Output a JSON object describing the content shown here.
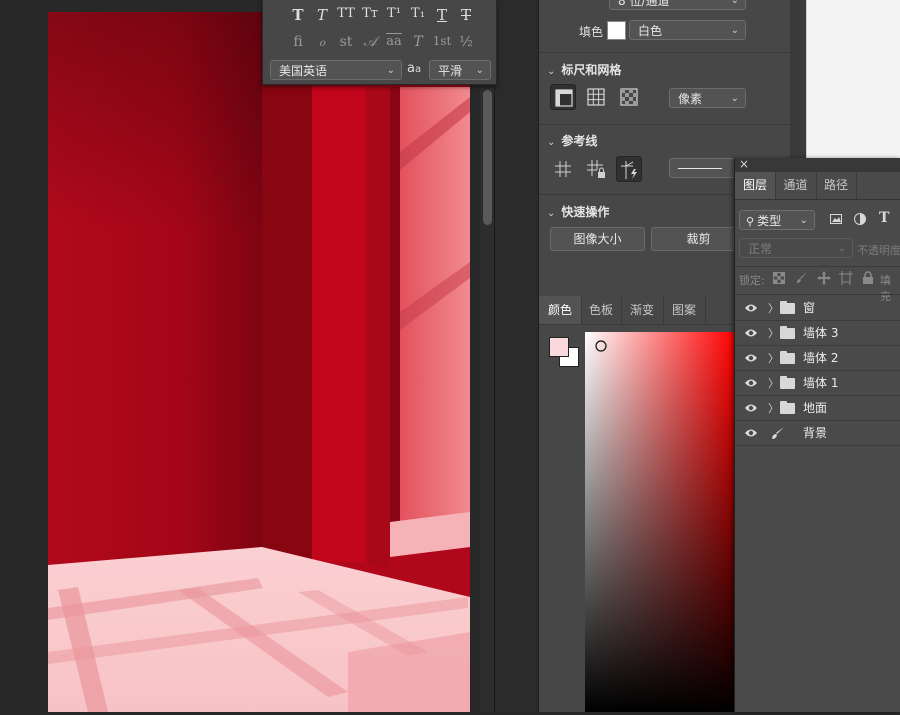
{
  "character_panel": {
    "glyph_row1": [
      "T",
      "T",
      "TT",
      "Tт",
      "T¹",
      "T₁",
      "T",
      "T"
    ],
    "glyph_row2": [
      "fi",
      "ℴ",
      "st",
      "𝒜",
      "aa",
      "T",
      "1st",
      "½"
    ],
    "language": "美国英语",
    "aa_label": "a a",
    "antialias": "平滑"
  },
  "properties": {
    "mode_value": "8 位/通道",
    "fill_label": "填色",
    "fill_value": "白色",
    "rulers_title": "标尺和网格",
    "units_value": "像素",
    "guides_title": "参考线",
    "quick_actions_title": "快速操作",
    "image_size_button": "图像大小",
    "crop_button": "裁剪"
  },
  "color_panel": {
    "tabs": [
      "颜色",
      "色板",
      "渐变",
      "图案"
    ],
    "foreground": "#f9d9dc",
    "background": "#ffffff",
    "hue": "#ff0000"
  },
  "layers_panel": {
    "close": "×",
    "tabs": [
      "图层",
      "通道",
      "路径"
    ],
    "filter_kind": "类型",
    "blend_mode": "正常",
    "opacity_label": "不透明度",
    "lock_label": "锁定:",
    "fill_label": "填充",
    "layers": [
      {
        "name": "窗",
        "type": "group"
      },
      {
        "name": "墙体 3",
        "type": "group"
      },
      {
        "name": "墙体 2",
        "type": "group"
      },
      {
        "name": "墙体 1",
        "type": "group"
      },
      {
        "name": "地面",
        "type": "group"
      },
      {
        "name": "背景",
        "type": "brush"
      }
    ]
  },
  "icons": {
    "rulers": "ruler-icon",
    "grid": "grid-icon",
    "pixel_grid": "pixel-grid-icon",
    "eye": "eye-icon",
    "folder": "folder-icon",
    "brush": "brush-icon"
  }
}
